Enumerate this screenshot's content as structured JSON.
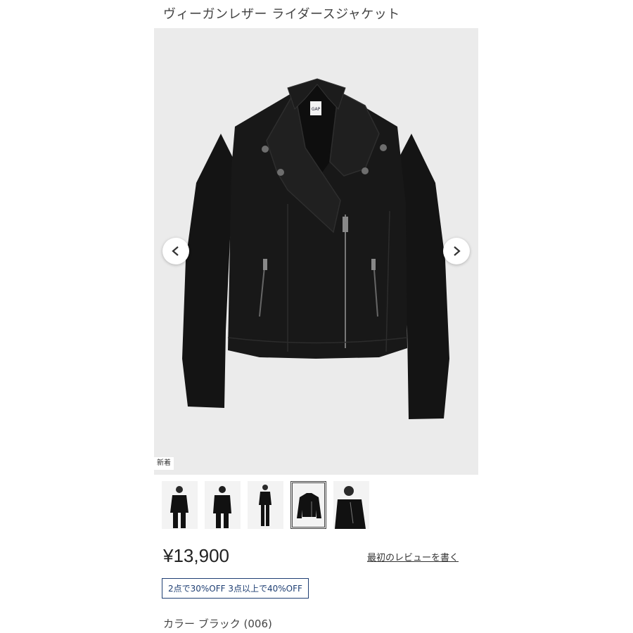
{
  "product": {
    "title": "ヴィーガンレザー ライダースジャケット",
    "badge": "新着",
    "price": "¥13,900",
    "review_link": "最初のレビューを書く",
    "promo": "2点で30%OFF 3点以上で40%OFF",
    "color_label": "カラー ブラック (006)",
    "brand_tag": "GAP"
  },
  "gallery": {
    "prev_icon": "chevron-left-icon",
    "next_icon": "chevron-right-icon",
    "selected_thumb": 4,
    "thumbnails": [
      {
        "name": "model-front-thumb"
      },
      {
        "name": "model-back-thumb"
      },
      {
        "name": "model-full-thumb"
      },
      {
        "name": "jacket-flat-thumb"
      },
      {
        "name": "model-closeup-thumb"
      }
    ]
  },
  "colors": {
    "promo_border": "#1f3f73",
    "gallery_bg": "#ebebeb",
    "jacket": "#111111"
  }
}
